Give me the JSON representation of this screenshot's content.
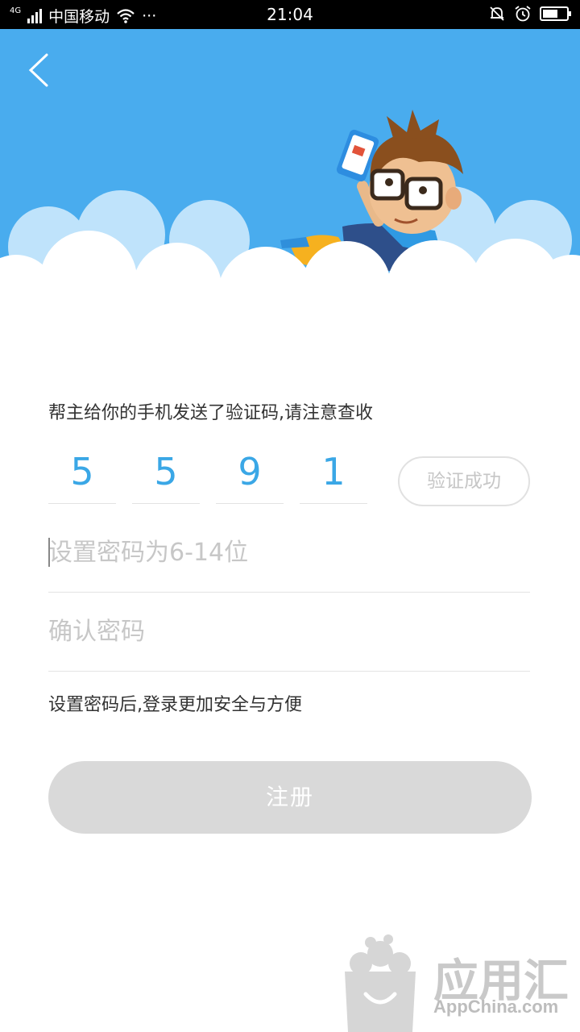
{
  "status_bar": {
    "network": "4G",
    "carrier": "中国移动",
    "dots": "···",
    "time": "21:04"
  },
  "colors": {
    "banner": "#49acee",
    "code_digits": "#3aa7e6",
    "register_bg": "#d9d9d9"
  },
  "icons": [
    "back-arrow-icon",
    "wifi-icon",
    "signal-icon",
    "mute-bell-icon",
    "alarm-icon",
    "battery-icon"
  ],
  "main": {
    "sent_hint": "帮主给你的手机发送了验证码,请注意查收",
    "code_digits": [
      "5",
      "5",
      "9",
      "1"
    ],
    "verify_status": "验证成功",
    "password_placeholder": "设置密码为6-14位",
    "confirm_placeholder": "确认密码",
    "safety_hint": "设置密码后,登录更加安全与方便",
    "register_label": "注册"
  },
  "watermark": {
    "title": "应用汇",
    "subtitle": "AppChina.com"
  }
}
